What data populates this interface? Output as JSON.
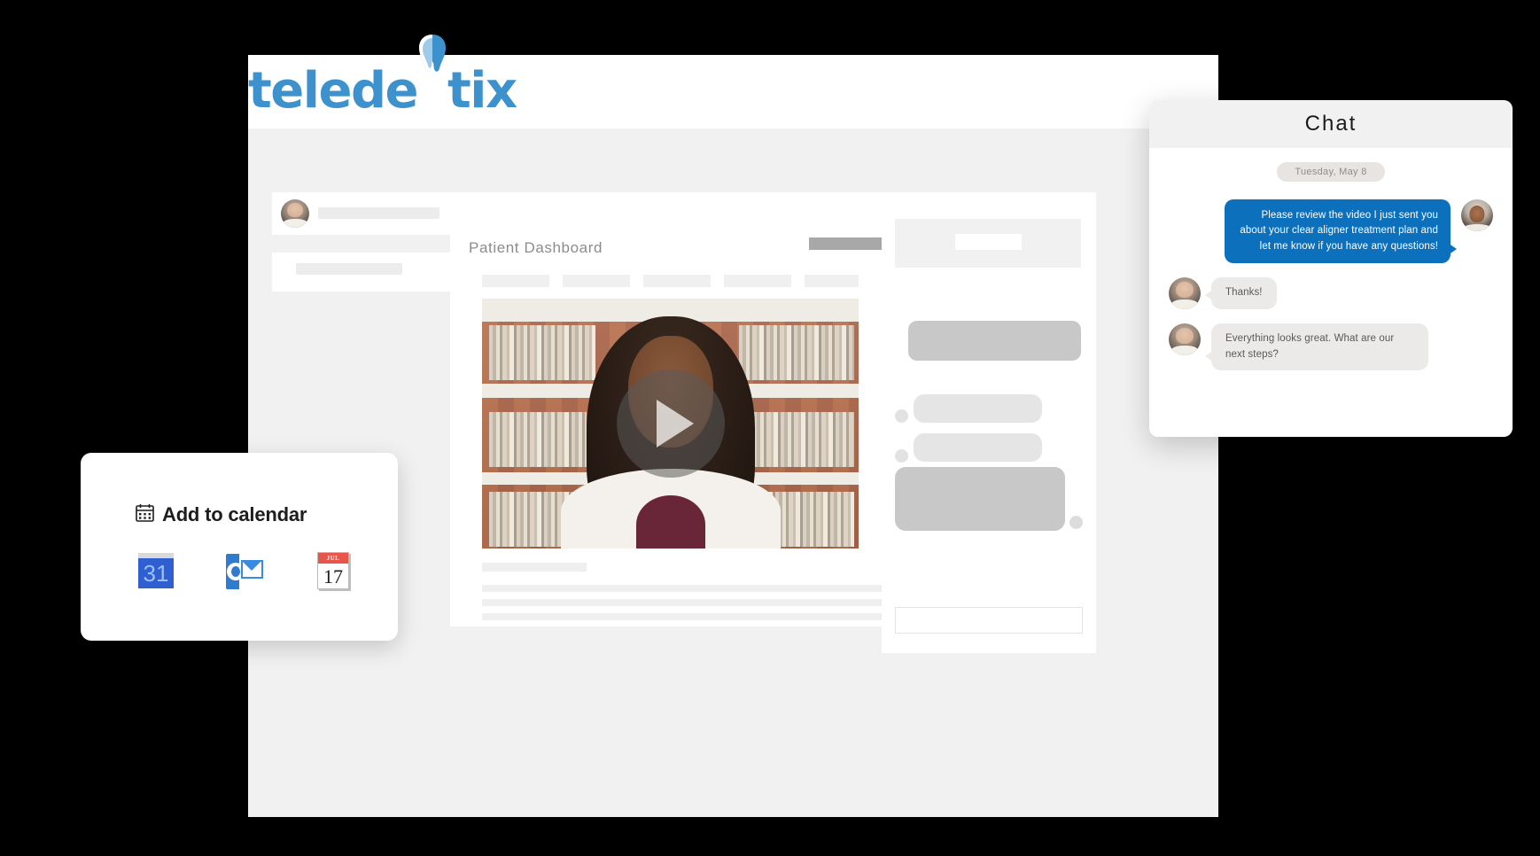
{
  "brand": {
    "name": "teledentix",
    "accent_color": "#3d92ce",
    "tooth_icon": "tooth-icon"
  },
  "app_window": {
    "sidebar": {
      "avatar": "user-avatar",
      "placeholder_rows": 2
    },
    "dashboard": {
      "title": "Patient Dashboard",
      "tabs_placeholder_count": 5,
      "video": {
        "play_icon": "play-icon",
        "thumbnail": "woman-in-office-video-thumbnail"
      },
      "body_placeholder_lines": 3
    },
    "right_panel": {
      "placeholder_label": "chat-skeleton-panel",
      "input_placeholder": ""
    }
  },
  "chat": {
    "title": "Chat",
    "date_divider": "Tuesday, May 8",
    "messages": [
      {
        "direction": "out",
        "text": "Please review the video I just sent you about your clear aligner treatment plan and let me know if you have any questions!",
        "avatar": "provider-avatar",
        "bubble_color": "#0d70bd"
      },
      {
        "direction": "in",
        "text": "Thanks!",
        "avatar": "patient-avatar",
        "bubble_color": "#eceae8"
      },
      {
        "direction": "in",
        "text": "Everything looks great. What are our next steps?",
        "avatar": "patient-avatar",
        "bubble_color": "#eceae8"
      }
    ]
  },
  "calendar_card": {
    "icon": "calendar-icon",
    "title": "Add to calendar",
    "options": [
      {
        "name": "google-calendar",
        "label": "31"
      },
      {
        "name": "outlook-calendar",
        "label": "O"
      },
      {
        "name": "apple-calendar",
        "month": "JUL",
        "day": "17"
      }
    ]
  }
}
